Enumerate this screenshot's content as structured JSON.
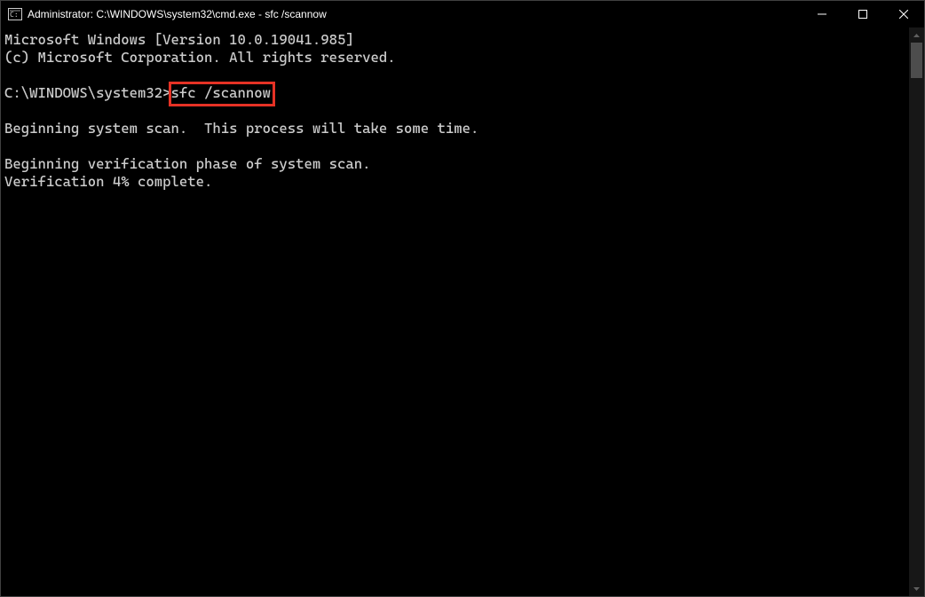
{
  "window": {
    "title": "Administrator: C:\\WINDOWS\\system32\\cmd.exe - sfc  /scannow"
  },
  "terminal": {
    "line1": "Microsoft Windows [Version 10.0.19041.985]",
    "line2": "(c) Microsoft Corporation. All rights reserved.",
    "blank1": "",
    "prompt": "C:\\WINDOWS\\system32>",
    "command": "sfc /scannow",
    "blank2": "",
    "line3": "Beginning system scan.  This process will take some time.",
    "blank3": "",
    "line4": "Beginning verification phase of system scan.",
    "line5": "Verification 4% complete."
  },
  "colors": {
    "highlight": "#e63225",
    "bg": "#000000",
    "fg": "#cccccc"
  }
}
